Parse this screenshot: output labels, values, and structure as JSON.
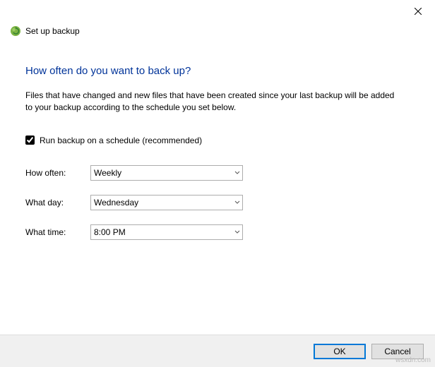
{
  "window": {
    "title": "Set up backup"
  },
  "main": {
    "heading": "How often do you want to back up?",
    "description": "Files that have changed and new files that have been created since your last backup will be added to your backup according to the schedule you set below.",
    "schedule_checkbox": {
      "label": "Run backup on a schedule (recommended)",
      "checked": true
    },
    "rows": {
      "how_often": {
        "label": "How often:",
        "value": "Weekly"
      },
      "what_day": {
        "label": "What day:",
        "value": "Wednesday"
      },
      "what_time": {
        "label": "What time:",
        "value": "8:00 PM"
      }
    }
  },
  "buttons": {
    "ok": "OK",
    "cancel": "Cancel"
  },
  "watermark": "wsxdn.com"
}
